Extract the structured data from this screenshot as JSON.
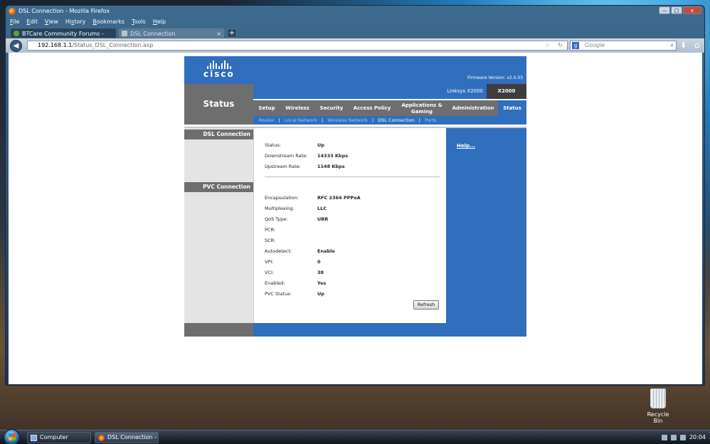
{
  "window": {
    "title": "DSL Connection - Mozilla Firefox",
    "controls": {
      "minimize": "—",
      "maximize": "□",
      "close": "x"
    }
  },
  "menubar": [
    {
      "label": "File",
      "key": "F",
      "rest": "ile"
    },
    {
      "label": "Edit",
      "key": "E",
      "rest": "dit"
    },
    {
      "label": "View",
      "key": "V",
      "rest": "iew"
    },
    {
      "label": "History",
      "key": "H",
      "rest": "istory",
      "pre": "Hi",
      "u": "s",
      "post": "tory"
    },
    {
      "label": "Bookmarks",
      "key": "B",
      "rest": "ookmarks"
    },
    {
      "label": "Tools",
      "key": "T",
      "rest": "ools"
    },
    {
      "label": "Help",
      "key": "H",
      "rest": "elp"
    }
  ],
  "tabs": [
    {
      "label": "BTCare Community Forums - BTCare...",
      "active": false
    },
    {
      "label": "DSL Connection",
      "active": true,
      "close": "×"
    }
  ],
  "newtab": "+",
  "nav": {
    "url_host": "192.168.1.1",
    "url_path": "/Status_DSL_Connection.asp",
    "search_placeholder": "Google",
    "search_engine_icon": "google-icon"
  },
  "router_page": {
    "brand": "cisco",
    "firmware": "Firmware Version: v2.0.03",
    "section_title": "Status",
    "product_name": "Linksys X2000",
    "model": "X2000",
    "tabs": [
      {
        "label": "Setup"
      },
      {
        "label": "Wireless"
      },
      {
        "label": "Security"
      },
      {
        "label": "Access Policy"
      },
      {
        "label": "Applications &",
        "label2": "Gaming"
      },
      {
        "label": "Administration"
      },
      {
        "label": "Status",
        "active": true
      }
    ],
    "subtabs": [
      "Router",
      "Local Network",
      "Wireless Network",
      "DSL Connection",
      "Ports"
    ],
    "subtab_sep": "|",
    "active_subtab": "DSL Connection",
    "sections": {
      "dsl": "DSL Connection",
      "pvc": "PVC Connection"
    },
    "help_link": "Help...",
    "dsl_rows": [
      {
        "label": "Status:",
        "value": "Up"
      },
      {
        "label": "Downstream Rate:",
        "value": "14333 Kbps"
      },
      {
        "label": "Upstream Rate:",
        "value": "1148 Kbps"
      }
    ],
    "pvc_rows": [
      {
        "label": "Encapsulation:",
        "value": "RFC 2364 PPPoA"
      },
      {
        "label": "Multiplexing:",
        "value": "LLC"
      },
      {
        "label": "QoS Type:",
        "value": "UBR"
      },
      {
        "label": "PCR:",
        "value": ""
      },
      {
        "label": "SCR:",
        "value": ""
      },
      {
        "label": "Autodetect:",
        "value": "Enable"
      },
      {
        "label": "VPI:",
        "value": "0"
      },
      {
        "label": "VCI:",
        "value": "38"
      },
      {
        "label": "Enabled:",
        "value": "Yes"
      },
      {
        "label": "PVC Status:",
        "value": "Up"
      }
    ],
    "refresh_label": "Refresh",
    "colors": {
      "primary": "#2f6fbd",
      "gray": "#6e6e6e"
    }
  },
  "desktop": {
    "recycle_bin": "Recycle Bin"
  },
  "taskbar": {
    "items": [
      {
        "label": "Computer"
      },
      {
        "label": "DSL Connection - M...",
        "active": true
      }
    ],
    "clock": "20:04"
  }
}
